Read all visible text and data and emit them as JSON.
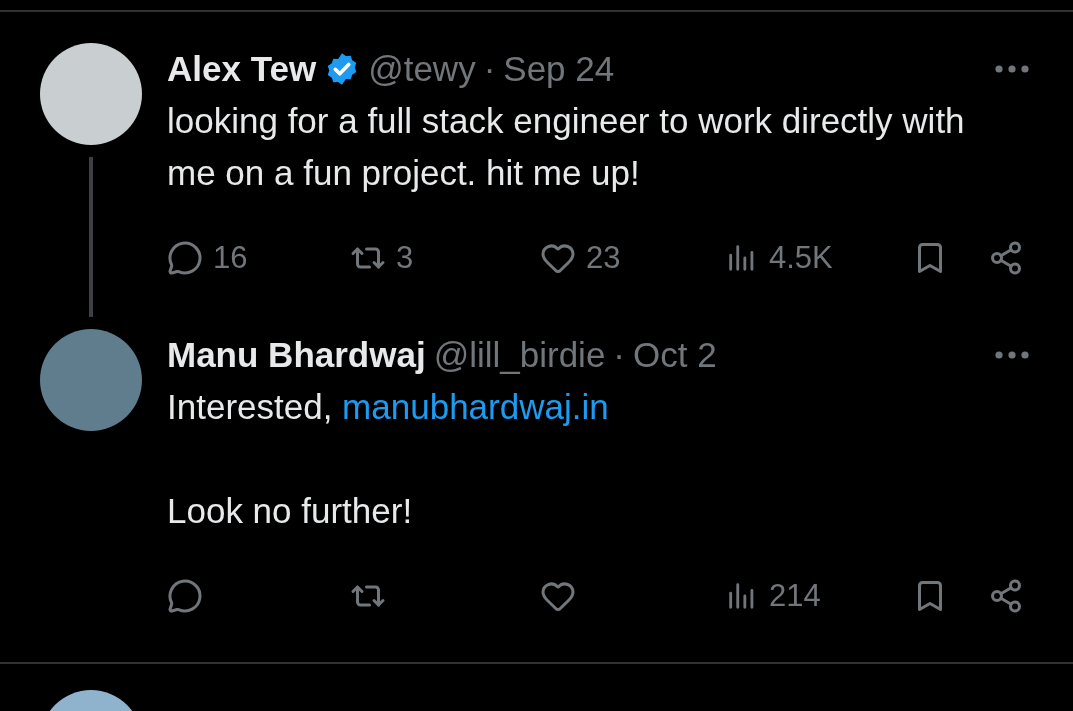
{
  "tweets": [
    {
      "author": "Alex Tew",
      "verified": true,
      "handle": "@tewy",
      "separator": "·",
      "date": "Sep 24",
      "thread_line": true,
      "paragraphs": [
        {
          "text": "looking for a full stack engineer to work directly with me on a fun project. hit me up!"
        }
      ],
      "actions": [
        {
          "kind": "reply",
          "count": "16"
        },
        {
          "kind": "retweet",
          "count": "3"
        },
        {
          "kind": "like",
          "count": "23"
        },
        {
          "kind": "views",
          "count": "4.5K"
        },
        {
          "kind": "bookmark"
        },
        {
          "kind": "share"
        }
      ]
    },
    {
      "author": "Manu Bhardwaj",
      "verified": false,
      "handle": "@lill_birdie",
      "separator": "·",
      "date": "Oct 2",
      "thread_line": false,
      "paragraphs": [
        {
          "text": "Interested, ",
          "link": "manubhardwaj.in"
        },
        {
          "text": "Look no further!"
        }
      ],
      "actions": [
        {
          "kind": "reply"
        },
        {
          "kind": "retweet"
        },
        {
          "kind": "like"
        },
        {
          "kind": "views",
          "count": "214"
        },
        {
          "kind": "bookmark"
        },
        {
          "kind": "share"
        }
      ]
    }
  ],
  "more_below": true
}
